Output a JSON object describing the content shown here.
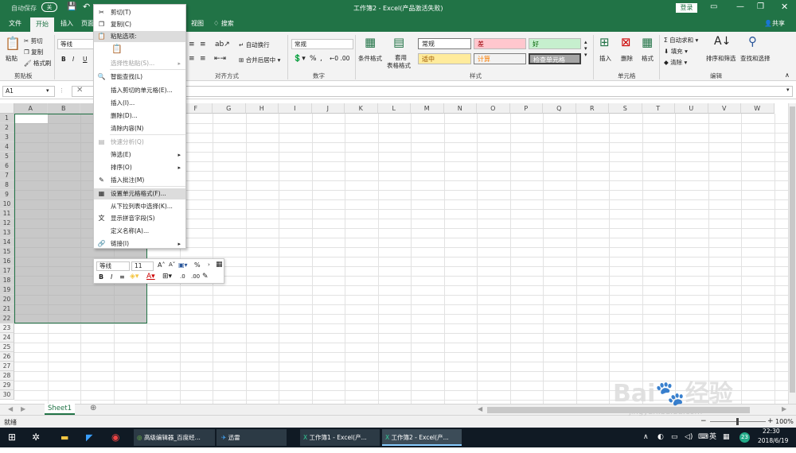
{
  "title_bar": {
    "autosave_label": "自动保存",
    "autosave_state": "关",
    "title": "工作簿2 - Excel(产品激活失败)",
    "login_button": "登录"
  },
  "tabs": [
    "文件",
    "开始",
    "插入",
    "页面",
    "视图"
  ],
  "tell_me": "搜索",
  "share": "共享",
  "ribbon": {
    "paste": "粘贴",
    "cut": "剪切",
    "copy": "复制",
    "format_painter": "格式刷",
    "clipboard_group": "剪贴板",
    "font_name": "等线",
    "bold": "B",
    "italic": "I",
    "underline": "U",
    "wrap_text": "自动换行",
    "merge_center": "合并后居中",
    "alignment_group": "对齐方式",
    "number_format": "常规",
    "percent": "%",
    "comma": ",",
    "number_group": "数字",
    "conditional_format": "条件格式",
    "table_format_1": "套用",
    "table_format_2": "表格格式",
    "styles": {
      "normal": "常规",
      "bad": "差",
      "good": "好",
      "neutral": "适中",
      "calculation": "计算",
      "check_cell": "检查单元格"
    },
    "styles_group": "样式",
    "insert": "插入",
    "delete": "删除",
    "format": "格式",
    "cells_group": "单元格",
    "autosum": "自动求和",
    "fill": "填充",
    "clear": "清除",
    "sort_filter": "排序和筛选",
    "find_select": "查找和选择",
    "editing_group": "编辑",
    "colors": {
      "bad_bg": "#ffc7ce",
      "bad_fg": "#9c0006",
      "good_bg": "#c6efce",
      "good_fg": "#006100",
      "neutral_bg": "#ffeb9c",
      "neutral_fg": "#9c5700",
      "calc_bg": "#f2f2f2",
      "calc_fg": "#fa7d00",
      "check_bg": "#a5a5a5"
    }
  },
  "name_box": "A1",
  "columns": [
    "A",
    "B",
    "C",
    "D",
    "E",
    "F",
    "G",
    "H",
    "I",
    "J",
    "K",
    "L",
    "M",
    "N",
    "O",
    "P",
    "Q",
    "R",
    "S",
    "T",
    "U",
    "V",
    "W"
  ],
  "rows": [
    "1",
    "2",
    "3",
    "4",
    "5",
    "6",
    "7",
    "8",
    "9",
    "10",
    "11",
    "12",
    "13",
    "14",
    "15",
    "16",
    "17",
    "18",
    "19",
    "20",
    "21",
    "22",
    "23",
    "24",
    "25",
    "26",
    "27",
    "28",
    "29",
    "30"
  ],
  "context_menu": {
    "items": [
      {
        "label": "剪切(T)",
        "icon": "scissors-icon",
        "glyph": "✂"
      },
      {
        "label": "复制(C)",
        "icon": "copy-icon",
        "glyph": "❐"
      },
      {
        "label": "粘贴选项:",
        "icon": "paste-icon",
        "glyph": "📋"
      },
      {
        "label": "选择性粘贴(S)...",
        "icon": "",
        "glyph": ""
      },
      {
        "label": "智能查找(L)",
        "icon": "smart-lookup-icon",
        "glyph": "🔍"
      },
      {
        "label": "插入剪切的单元格(E)...",
        "icon": "",
        "glyph": ""
      },
      {
        "label": "插入(I)...",
        "icon": "",
        "glyph": ""
      },
      {
        "label": "删除(D)...",
        "icon": "",
        "glyph": ""
      },
      {
        "label": "清除内容(N)",
        "icon": "",
        "glyph": ""
      },
      {
        "label": "快速分析(Q)",
        "icon": "quick-analysis-icon",
        "glyph": "▤"
      },
      {
        "label": "筛选(E)",
        "icon": "",
        "glyph": ""
      },
      {
        "label": "排序(O)",
        "icon": "",
        "glyph": ""
      },
      {
        "label": "插入批注(M)",
        "icon": "comment-icon",
        "glyph": "✎"
      },
      {
        "label": "设置单元格格式(F)...",
        "icon": "format-cells-icon",
        "glyph": "▦"
      },
      {
        "label": "从下拉列表中选择(K)...",
        "icon": "",
        "glyph": ""
      },
      {
        "label": "显示拼音字段(S)",
        "icon": "pinyin-icon",
        "glyph": "文"
      },
      {
        "label": "定义名称(A)...",
        "icon": "",
        "glyph": ""
      },
      {
        "label": "链接(I)",
        "icon": "link-icon",
        "glyph": "🔗"
      }
    ]
  },
  "mini_toolbar": {
    "font": "等线",
    "size": "11",
    "bold": "B",
    "italic": "I",
    "percent": "%"
  },
  "sheet_tab": "Sheet1",
  "status": {
    "ready": "就绪",
    "zoom": "100%"
  },
  "taskbar": {
    "items": [
      "高级编辑器_百度经...",
      "迅雷",
      "工作簿1 - Excel(产...",
      "工作簿2 - Excel(产..."
    ],
    "ime": "英",
    "badge": "23",
    "time": "22:30",
    "date": "2018/6/19"
  },
  "watermark": {
    "brand": "Bai",
    "suffix": "经验",
    "url": "jingyan.baidu.com"
  }
}
